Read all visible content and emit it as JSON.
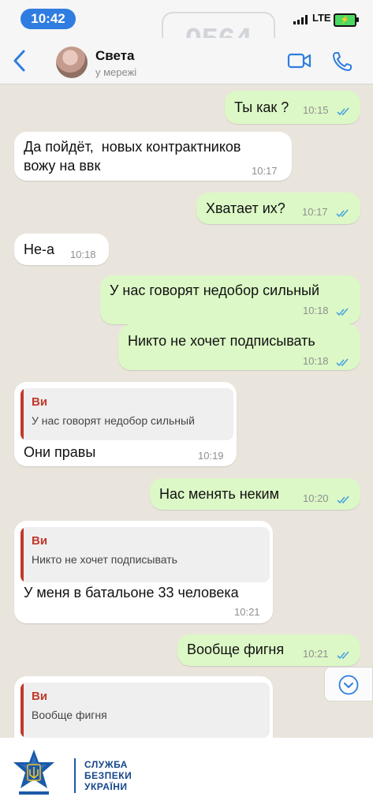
{
  "status_bar": {
    "time": "10:42",
    "network": "LTE",
    "watermark": "0564"
  },
  "contact": {
    "name": "Света",
    "status": "у мережі"
  },
  "messages": [
    {
      "dir": "out",
      "text": "Ты как ?",
      "time": "10:15"
    },
    {
      "dir": "in",
      "text": "Да пойдёт,  новых контрактников\nвожу на ввк",
      "time": "10:17"
    },
    {
      "dir": "out",
      "text": "Хватает их?",
      "time": "10:17"
    },
    {
      "dir": "in",
      "text": "Не-а",
      "time": "10:18"
    },
    {
      "dir": "out",
      "text": "У нас говорят недобор сильный",
      "time": "10:18"
    },
    {
      "dir": "out",
      "text": "Никто не хочет подписывать",
      "time": "10:18"
    },
    {
      "dir": "in",
      "quote_author": "Ви",
      "quote_text": "У нас говорят недобор сильный",
      "text": "Они правы",
      "time": "10:19"
    },
    {
      "dir": "out",
      "text": "Нас менять неким",
      "time": "10:20"
    },
    {
      "dir": "in",
      "quote_author": "Ви",
      "quote_text": "Никто не хочет подписывать",
      "text": "У меня в батальоне 33 человека",
      "time": "10:21"
    },
    {
      "dir": "out",
      "text": "Вообще фигня",
      "time": "10:21"
    },
    {
      "dir": "in",
      "quote_author": "Ви",
      "quote_text": "Вообще фигня"
    }
  ],
  "footer": {
    "line1": "СЛУЖБА",
    "line2": "БЕЗПЕКИ",
    "line3": "УКРАЇНИ"
  },
  "colors": {
    "accent": "#2f7de0",
    "outgoing_bubble": "#dcf8c6",
    "incoming_bubble": "#ffffff",
    "quote_bar": "#c0392b",
    "sbu_blue": "#15468c"
  }
}
